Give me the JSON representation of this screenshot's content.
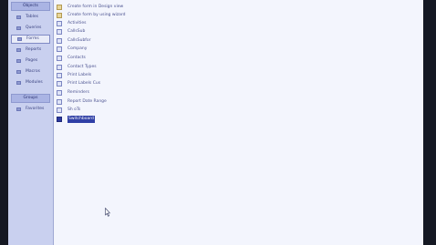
{
  "objects_group_label": "Objects",
  "groups_group_label": "Groups",
  "nav_items": [
    {
      "label": "Tables",
      "icon": "table-icon"
    },
    {
      "label": "Queries",
      "icon": "query-icon"
    },
    {
      "label": "Forms",
      "icon": "form-icon",
      "selected": true
    },
    {
      "label": "Reports",
      "icon": "report-icon"
    },
    {
      "label": "Pages",
      "icon": "page-icon"
    },
    {
      "label": "Macros",
      "icon": "macro-icon"
    },
    {
      "label": "Modules",
      "icon": "module-icon"
    }
  ],
  "group_items": [
    {
      "label": "Favorites",
      "icon": "folder-icon"
    }
  ],
  "list_items": [
    {
      "label": "Create form in Design view",
      "icon": "design-view-icon"
    },
    {
      "label": "Create form by using wizard",
      "icon": "wizard-icon"
    },
    {
      "label": "Activities",
      "icon": "form-icon"
    },
    {
      "label": "CallsSub",
      "icon": "form-icon"
    },
    {
      "label": "CallsSubfor",
      "icon": "form-icon"
    },
    {
      "label": "Company",
      "icon": "form-icon"
    },
    {
      "label": "Contacts",
      "icon": "form-icon"
    },
    {
      "label": "Contact Types",
      "icon": "form-icon"
    },
    {
      "label": "Print Labels",
      "icon": "form-icon"
    },
    {
      "label": "Print Labels Cus",
      "icon": "form-icon"
    },
    {
      "label": "Reminders",
      "icon": "form-icon"
    },
    {
      "label": "Report Date Range",
      "icon": "form-icon"
    },
    {
      "label": "Sh oTs",
      "icon": "form-icon"
    },
    {
      "label": "Switchboard",
      "icon": "form-icon",
      "selected": true
    }
  ],
  "colors": {
    "nav_background": "#c9d0ef",
    "list_background": "#f3f5fd",
    "selection": "#2f3fa6"
  }
}
